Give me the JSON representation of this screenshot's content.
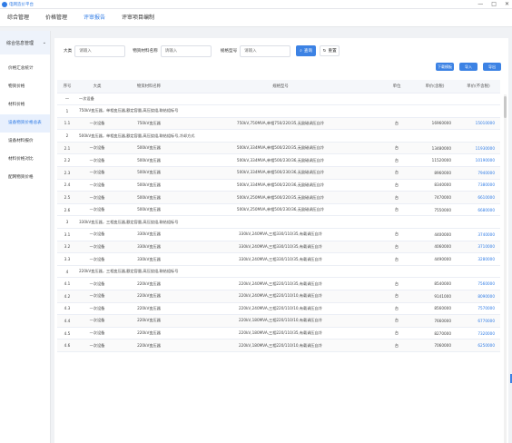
{
  "app": {
    "name": "电网造价平台"
  },
  "window": {
    "minimize": "—",
    "maximize": "□",
    "close": "✕"
  },
  "topnav": [
    "综合管理",
    "价格管理",
    "评审报告",
    "评审项目编制"
  ],
  "sidebar": {
    "head": "综合信息管理",
    "items": [
      "价格汇总统计",
      "物资价格",
      "材料价格",
      "设备物资价格总表",
      "设备材料报价",
      "材料价格对比",
      "配网物资价格"
    ]
  },
  "filters": {
    "label1": "大类",
    "placeholder1": "请输入",
    "label2": "物资材料名称",
    "placeholder2": "请输入",
    "label3": "规格型号",
    "placeholder3": "请输入",
    "search": "查询",
    "reset": "重置"
  },
  "actions": {
    "import": "下载模板",
    "export": "导入",
    "add": "导出"
  },
  "table": {
    "headers": [
      "序号",
      "大类",
      "物资材料名称",
      "规格型号",
      "单位",
      "单价(含税)",
      "单价(不含税)"
    ],
    "rows": [
      {
        "type": "group",
        "no": "一",
        "title": "一次设备"
      },
      {
        "type": "group",
        "no": "1",
        "title": "750kV变压器，单相变压器,额定容量,高压绕组,联结组标号"
      },
      {
        "type": "row",
        "no": "1.1",
        "cat": "一次设备",
        "name": "750kV变压器",
        "spec": "750kV,750MVA,单相750/220/35,无励磁调压自冷",
        "unit": "台",
        "p1": "16960000",
        "p2": "15010000"
      },
      {
        "type": "group",
        "no": "2",
        "title": "500kV变压器，单相变压器,额定容量,高压绕组,联结组标号,冷却方式"
      },
      {
        "type": "row",
        "no": "2.1",
        "cat": "一次设备",
        "name": "500kV变压器",
        "spec": "500kV,334MVA,单相500/220/35,无励磁调压自冷",
        "unit": "台",
        "p1": "13480000",
        "p2": "11930000"
      },
      {
        "type": "row",
        "no": "2.2",
        "cat": "一次设备",
        "name": "500kV变压器",
        "spec": "500kV,334MVA,单相500/230/36,无励磁调压自冷",
        "unit": "台",
        "p1": "11520000",
        "p2": "10190000"
      },
      {
        "type": "row",
        "no": "2.3",
        "cat": "一次设备",
        "name": "500kV变压器",
        "spec": "500kV,334MVA,单相500/230/36,无励磁调压自冷",
        "unit": "台",
        "p1": "8960000",
        "p2": "7940000"
      },
      {
        "type": "row",
        "no": "2.4",
        "cat": "一次设备",
        "name": "500kV变压器",
        "spec": "500kV,334MVA,单相500/220/36,无励磁调压自冷",
        "unit": "台",
        "p1": "8340000",
        "p2": "7380000"
      },
      {
        "type": "row",
        "no": "2.5",
        "cat": "一次设备",
        "name": "500kV变压器",
        "spec": "500kV,250MVA,单相500/220/35,无励磁调压自冷",
        "unit": "台",
        "p1": "7470000",
        "p2": "6610000"
      },
      {
        "type": "row",
        "no": "2.6",
        "cat": "一次设备",
        "name": "500kV变压器",
        "spec": "500kV,250MVA,单相500/230/36,无励磁调压自冷",
        "unit": "台",
        "p1": "7550000",
        "p2": "6680000"
      },
      {
        "type": "group",
        "no": "3",
        "title": "330kV变压器，三相变压器,额定容量,高压绕组,联结组标号"
      },
      {
        "type": "row",
        "no": "3.1",
        "cat": "一次设备",
        "name": "330kV变压器",
        "spec": "330kV,240MVA,三相330/110/35,有载调压自冷",
        "unit": "台",
        "p1": "4400000",
        "p2": "3740000"
      },
      {
        "type": "row",
        "no": "3.2",
        "cat": "一次设备",
        "name": "330kV变压器",
        "spec": "330kV,240MVA,三相330/110/35,有载调压自冷",
        "unit": "台",
        "p1": "4060000",
        "p2": "3710000"
      },
      {
        "type": "row",
        "no": "3.3",
        "cat": "一次设备",
        "name": "330kV变压器",
        "spec": "330kV,240MVA,三相330/110/35,有载调压自冷",
        "unit": "台",
        "p1": "4490000",
        "p2": "3280000"
      },
      {
        "type": "group",
        "no": "4",
        "title": "220kV变压器，三相变压器,额定容量,高压绕组,联结组标号"
      },
      {
        "type": "row",
        "no": "4.1",
        "cat": "一次设备",
        "name": "220kV变压器",
        "spec": "220kV,240MVA,三相220/110/35,有载调压自冷",
        "unit": "台",
        "p1": "8540000",
        "p2": "7560000"
      },
      {
        "type": "row",
        "no": "4.2",
        "cat": "一次设备",
        "name": "220kV变压器",
        "spec": "220kV,240MVA,三相220/110/10,有载调压自冷",
        "unit": "台",
        "p1": "9141000",
        "p2": "8090000"
      },
      {
        "type": "row",
        "no": "4.3",
        "cat": "一次设备",
        "name": "220kV变压器",
        "spec": "220kV,240MVA,三相220/110/10,有载调压自冷",
        "unit": "台",
        "p1": "8560000",
        "p2": "7570000"
      },
      {
        "type": "row",
        "no": "4.4",
        "cat": "一次设备",
        "name": "220kV变压器",
        "spec": "220kV,180MVA,三相220/110/10,有载调压自冷",
        "unit": "台",
        "p1": "7660000",
        "p2": "6770000"
      },
      {
        "type": "row",
        "no": "4.5",
        "cat": "一次设备",
        "name": "220kV变压器",
        "spec": "220kV,180MVA,三相220/110/35,有载调压自冷",
        "unit": "台",
        "p1": "8270000",
        "p2": "7320000"
      },
      {
        "type": "row",
        "no": "4.6",
        "cat": "一次设备",
        "name": "220kV变压器",
        "spec": "220kV,180MVA,三相220/110/10,有载调压自冷",
        "unit": "台",
        "p1": "7060000",
        "p2": "6250000"
      }
    ]
  }
}
